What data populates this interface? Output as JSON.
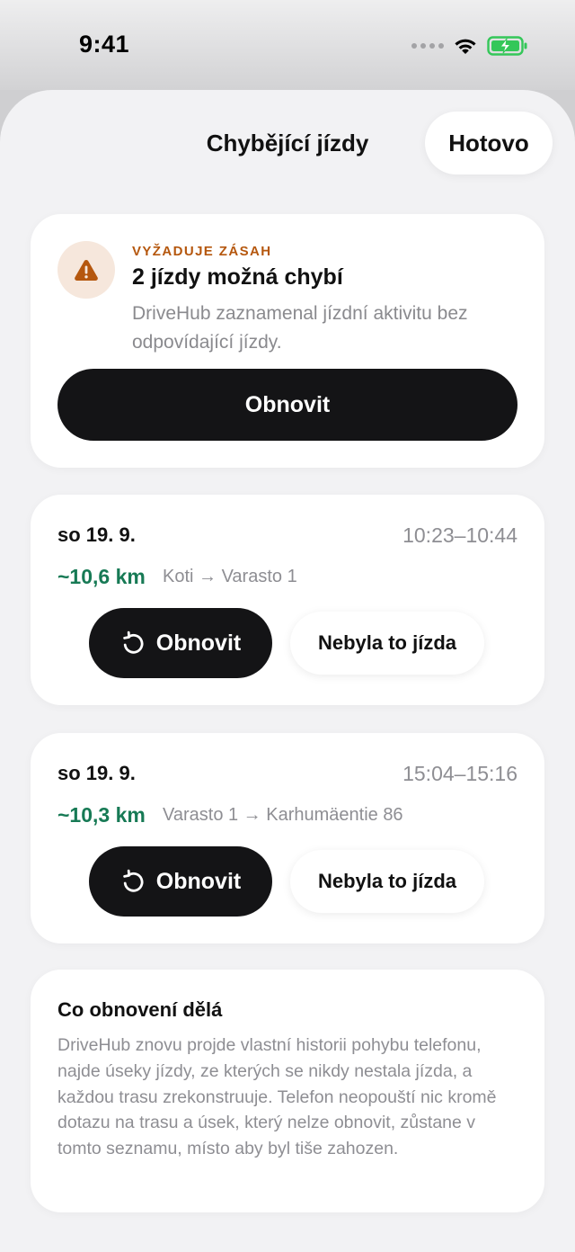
{
  "status_bar": {
    "time": "9:41"
  },
  "header": {
    "title": "Chybějící jízdy",
    "done_label": "Hotovo"
  },
  "alert": {
    "eyebrow": "VYŽADUJE ZÁSAH",
    "title": "2 jízdy možná chybí",
    "description": "DriveHub zaznamenal jízdní aktivitu bez odpovídající jízdy.",
    "button_label": "Obnovit",
    "icon": "warning-icon",
    "accent_color": "#b5570e"
  },
  "trips": [
    {
      "date": "so 19. 9.",
      "time_range": "10:23–10:44",
      "distance": "~10,6 km",
      "route": "Koti → Varasto 1",
      "restore_label": "Obnovit",
      "dismiss_label": "Nebyla to jízda"
    },
    {
      "date": "so 19. 9.",
      "time_range": "15:04–15:16",
      "distance": "~10,3 km",
      "route": "Varasto 1 → Karhumäentie 86",
      "restore_label": "Obnovit",
      "dismiss_label": "Nebyla to jízda"
    }
  ],
  "info": {
    "title": "Co obnovení dělá",
    "body": "DriveHub znovu projde vlastní historii pohybu telefonu, najde úseky jízdy, ze kterých se nikdy nestala jízda, a každou trasu zrekonstruuje. Telefon neopouští nic kromě dotazu na trasu a úsek, který nelze obnovit, zůstane v tomto seznamu, místo aby byl tiše zahozen."
  },
  "colors": {
    "distance_green": "#177a55",
    "primary_dark": "#141416",
    "battery_green": "#34c759"
  }
}
